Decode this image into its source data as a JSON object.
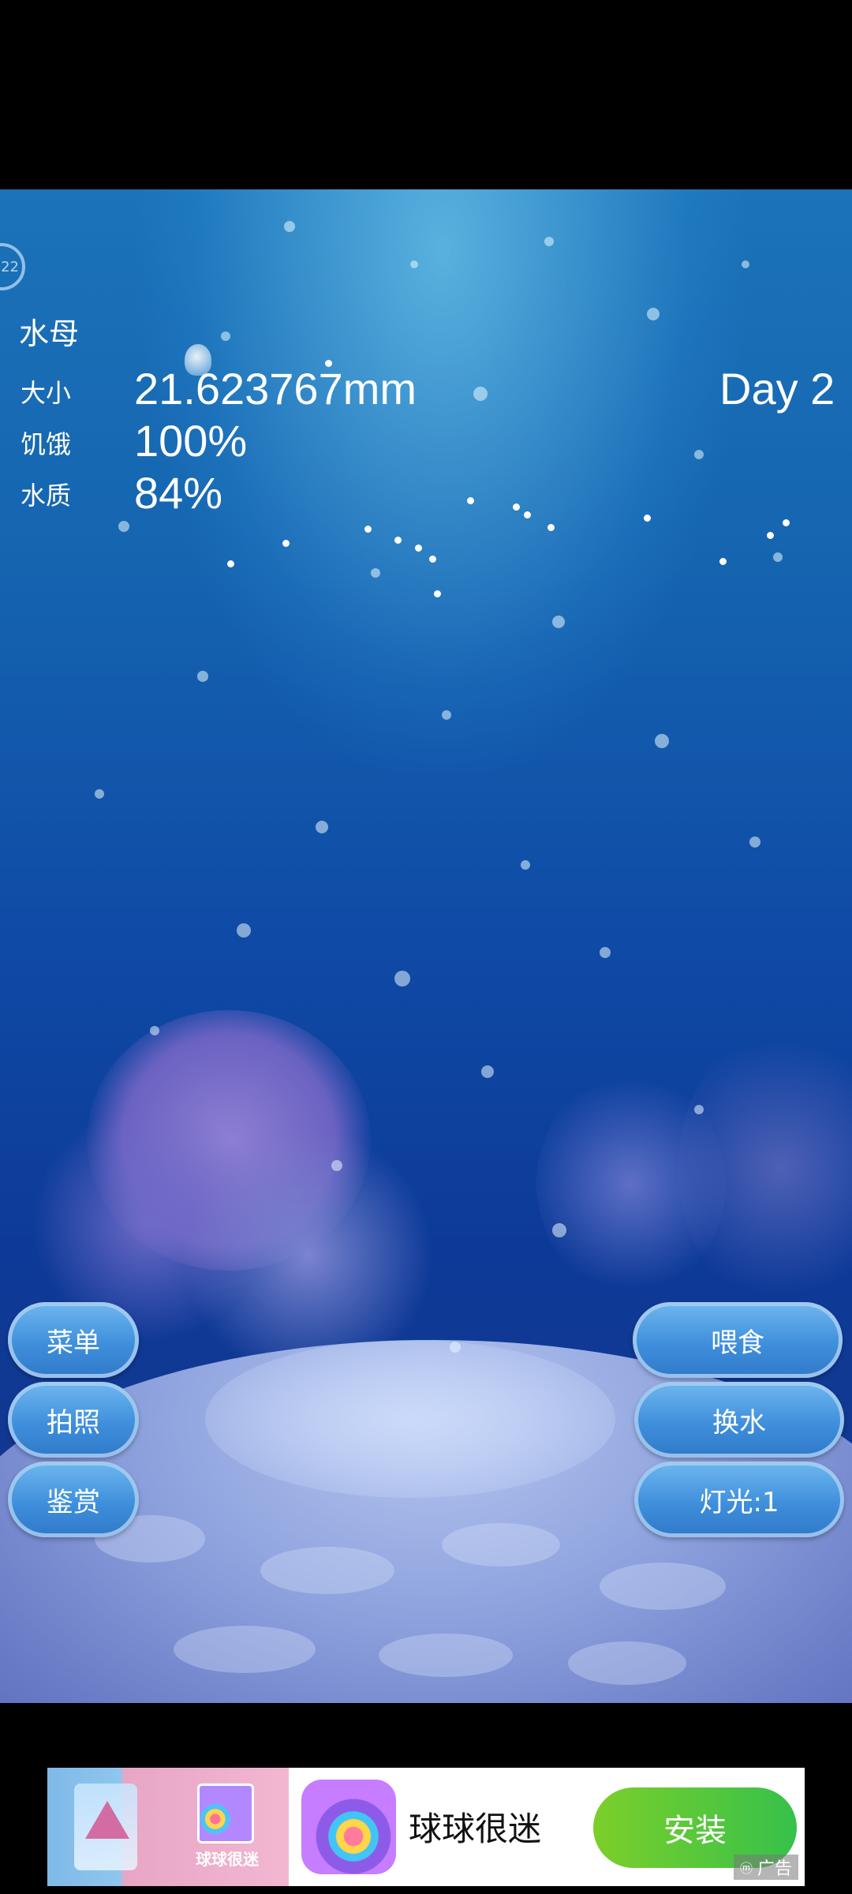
{
  "hud": {
    "creature_name": "水母",
    "size_label": "大小",
    "size_value": "21.623767mm",
    "hunger_label": "饥饿",
    "hunger_value": "100%",
    "water_label": "水质",
    "water_value": "84%",
    "day": "Day 2",
    "ring_text": "22"
  },
  "buttons": {
    "menu": "菜单",
    "photo": "拍照",
    "appreciate": "鉴赏",
    "feed": "喂食",
    "change_water": "换水",
    "light": "灯光:1"
  },
  "ad": {
    "image_caption": "球球很迷",
    "app_name": "球球很迷",
    "install": "安装",
    "ad_tag": "广告",
    "ad_tag_icon": "ad-mark-icon"
  }
}
